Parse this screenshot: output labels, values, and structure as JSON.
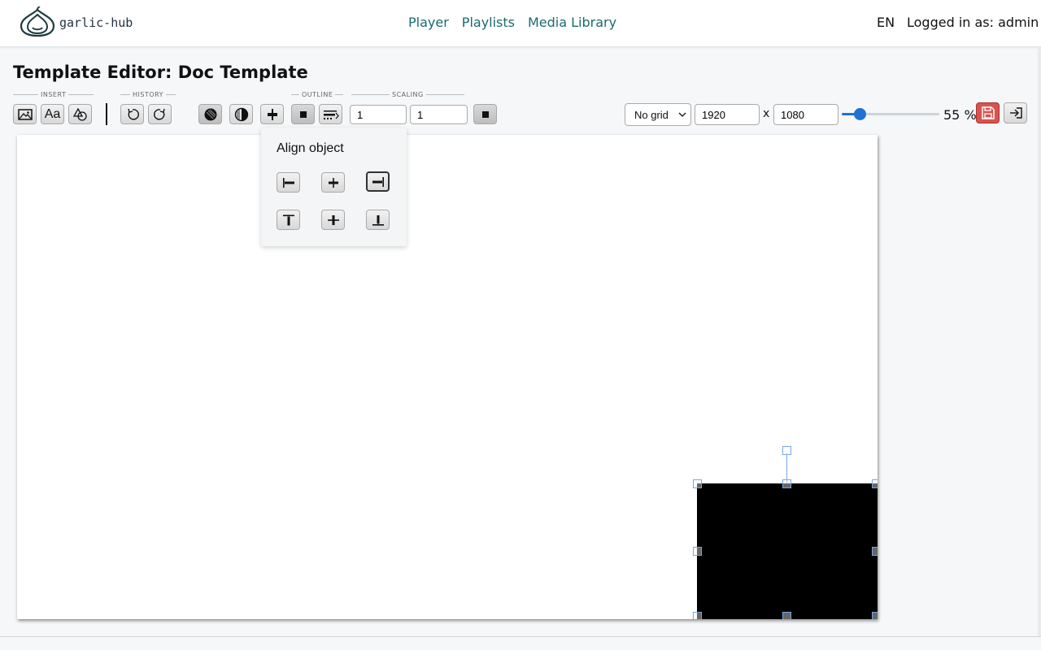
{
  "header": {
    "logo_text": "garlic-hub",
    "nav": [
      {
        "label": "Player"
      },
      {
        "label": "Playlists"
      },
      {
        "label": "Media Library"
      }
    ],
    "language": "EN",
    "user_label": "Logged in as: admin"
  },
  "page": {
    "title": "Template Editor: Doc Template"
  },
  "toolbar": {
    "groups": {
      "insert": "INSERT",
      "history": "HISTORY",
      "outline": "OUTLINE",
      "scaling": "SCALING"
    },
    "insert_text_label": "Aa",
    "scale_x": "1",
    "scale_y": "1",
    "grid_select": "No grid",
    "canvas_width": "1920",
    "canvas_height": "1080",
    "times": "x",
    "zoom_percent": 55,
    "zoom_label": "55 %",
    "accent_color": "#1f72d4",
    "save_color": "#d9534f"
  },
  "align_popover": {
    "title": "Align object",
    "buttons": [
      {
        "icon": "align-left-icon"
      },
      {
        "icon": "align-center-horizontal-icon"
      },
      {
        "icon": "align-right-icon",
        "active": true
      },
      {
        "icon": "align-top-icon"
      },
      {
        "icon": "align-middle-vertical-icon"
      },
      {
        "icon": "align-bottom-icon"
      }
    ]
  },
  "canvas": {
    "background": "#ffffff",
    "selected_object": {
      "type": "rectangle",
      "fill": "#000000"
    }
  }
}
